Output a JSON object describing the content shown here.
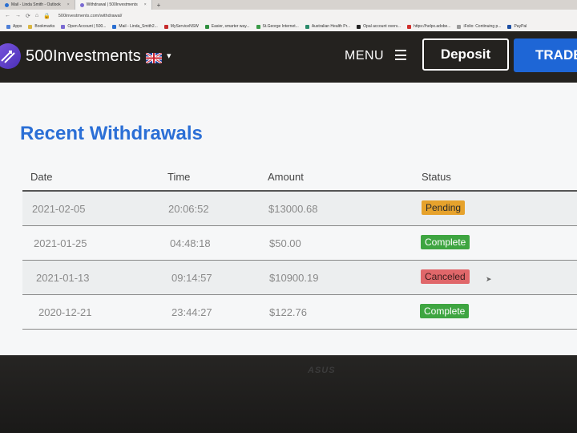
{
  "browser": {
    "tabs": [
      {
        "label": "Mail - Linda Smith - Outlook",
        "active": false
      },
      {
        "label": "Withdrawal | 500Investments",
        "active": true
      }
    ],
    "new_tab": "+",
    "url": "500investments.com/withdrawal/",
    "bookmarks": [
      "Apps",
      "Bookmarks",
      "Open Account | 500...",
      "Mail - Linda_Smith2...",
      "MyServiceNSW",
      "Easier, smarter way...",
      "St.George Internet...",
      "Australian Health Pr...",
      "Opal account overv...",
      "https://helpx.adobe...",
      "iFolio: Continuing p...",
      "PayPal"
    ]
  },
  "header": {
    "brand": "500Investments",
    "menu_label": "MENU",
    "deposit_label": "Deposit",
    "trade_label": "TRADE"
  },
  "page": {
    "section_title": "Recent Withdrawals",
    "columns": [
      "Date",
      "Time",
      "Amount",
      "Status"
    ],
    "rows": [
      {
        "date": "2021-02-05",
        "time": "20:06:52",
        "amount": "$13000.68",
        "status": "Pending"
      },
      {
        "date": "2021-01-25",
        "time": "04:48:18",
        "amount": "$50.00",
        "status": "Complete"
      },
      {
        "date": "2021-01-13",
        "time": "09:14:57",
        "amount": "$10900.19",
        "status": "Canceled"
      },
      {
        "date": "2020-12-21",
        "time": "23:44:27",
        "amount": "$122.76",
        "status": "Complete"
      }
    ]
  },
  "monitor": {
    "brand": "ASUS"
  },
  "colors": {
    "header_bg": "#24221f",
    "title_blue": "#2b6fd6",
    "trade_blue": "#1e66d6",
    "pending": "#e6a22c",
    "complete": "#3ea541",
    "canceled": "#e0676a"
  }
}
